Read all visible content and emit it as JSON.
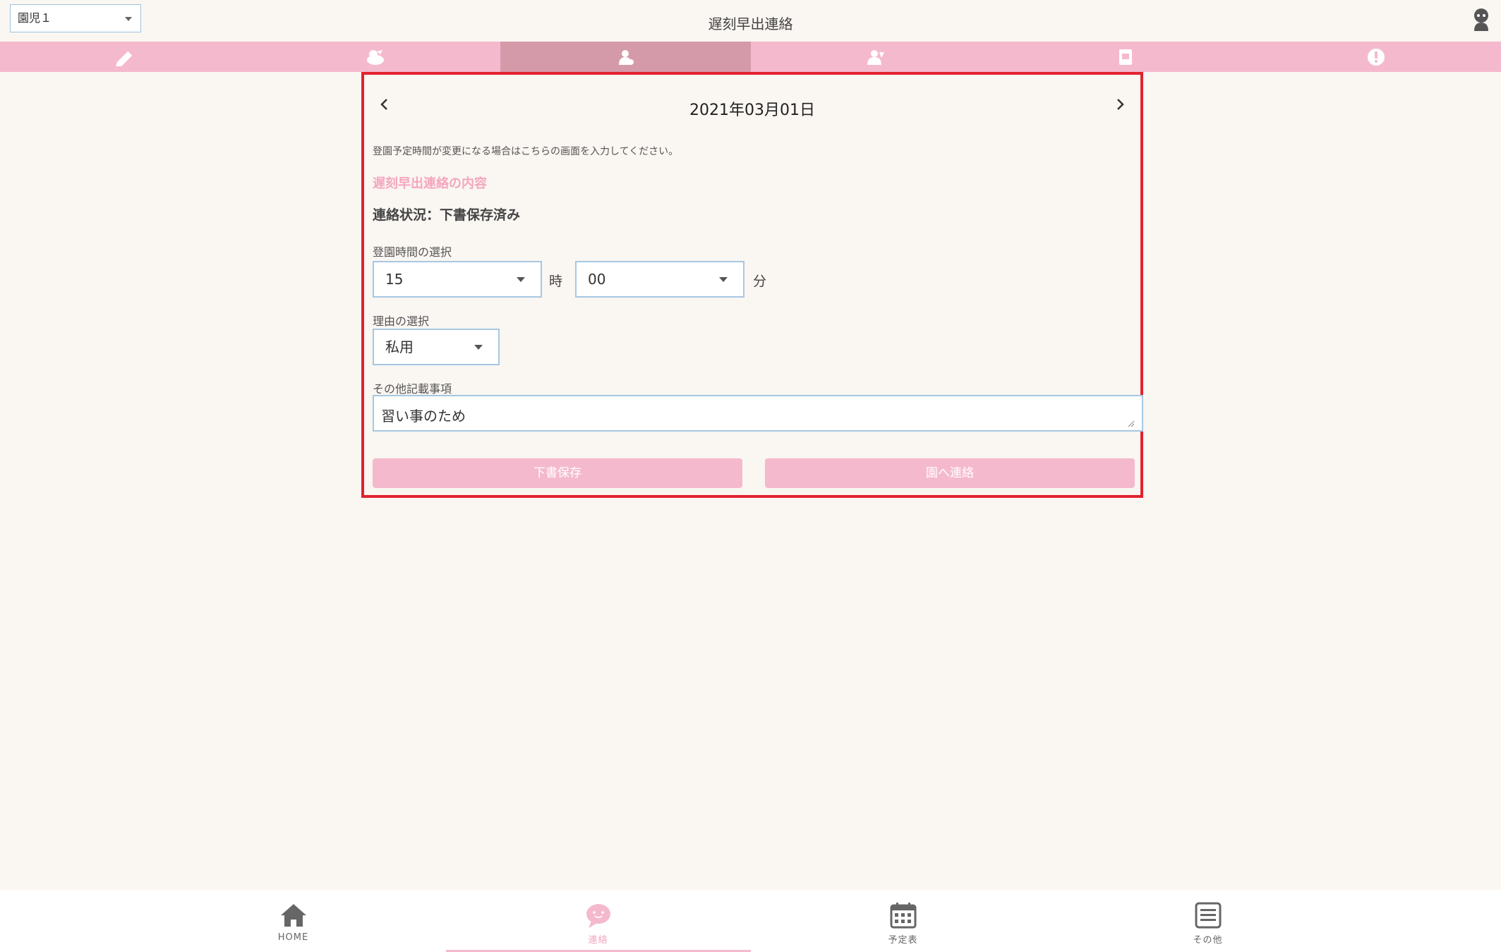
{
  "header": {
    "child_select_value": "園児１",
    "title": "遅刻早出連絡"
  },
  "tabs": [
    {
      "icon": "pencil-icon"
    },
    {
      "icon": "sick-icon"
    },
    {
      "icon": "late-icon",
      "active": true
    },
    {
      "icon": "absence-icon"
    },
    {
      "icon": "calendar-note-icon"
    },
    {
      "icon": "alert-icon"
    }
  ],
  "form": {
    "date": "2021年03月01日",
    "info_text": "登園予定時間が変更になる場合はこちらの画面を入力してください。",
    "section_title": "遅刻早出連絡の内容",
    "status": "連絡状況：下書保存済み",
    "time_label": "登園時間の選択",
    "hour_value": "15",
    "hour_unit": "時",
    "minute_value": "00",
    "minute_unit": "分",
    "reason_label": "理由の選択",
    "reason_value": "私用",
    "notes_label": "その他記載事項",
    "notes_value": "習い事のため",
    "draft_button": "下書保存",
    "send_button": "園へ連絡"
  },
  "bottom_nav": [
    {
      "label": "HOME",
      "icon": "home-icon"
    },
    {
      "label": "連絡",
      "icon": "chat-bubble-icon",
      "active": true
    },
    {
      "label": "予定表",
      "icon": "calendar-icon"
    },
    {
      "label": "その他",
      "icon": "menu-list-icon"
    }
  ],
  "colors": {
    "accent_pink": "#f5b9cd",
    "active_tab": "#d49aaa",
    "highlight_border": "#e2222e",
    "input_border": "#a6c8e2",
    "background": "#faf6f2"
  }
}
